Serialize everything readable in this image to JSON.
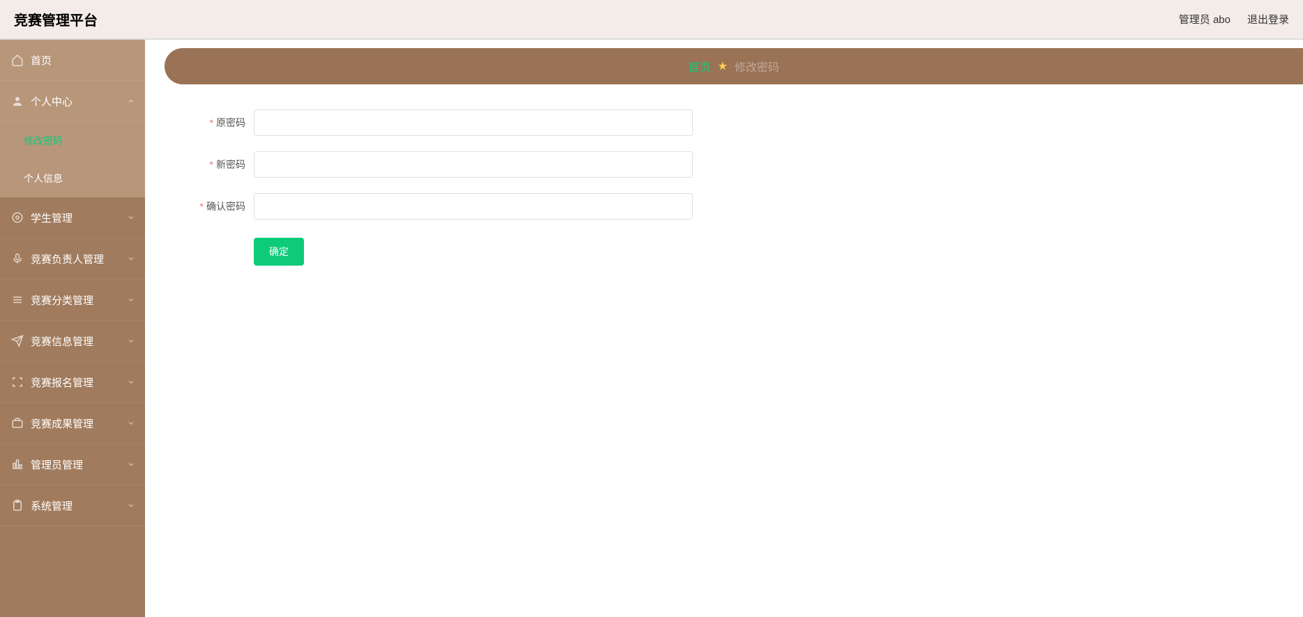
{
  "header": {
    "title": "竞赛管理平台",
    "user_label": "管理员 abo",
    "logout_label": "退出登录"
  },
  "sidebar": {
    "items": [
      {
        "label": "首页",
        "icon": "home",
        "expandable": false,
        "light": true
      },
      {
        "label": "个人中心",
        "icon": "user",
        "expandable": true,
        "light": true,
        "expanded": true,
        "children": [
          {
            "label": "修改密码",
            "active": true
          },
          {
            "label": "个人信息",
            "active": false
          }
        ]
      },
      {
        "label": "学生管理",
        "icon": "gear",
        "expandable": true
      },
      {
        "label": "竞赛负责人管理",
        "icon": "mic",
        "expandable": true
      },
      {
        "label": "竞赛分类管理",
        "icon": "list",
        "expandable": true
      },
      {
        "label": "竞赛信息管理",
        "icon": "send",
        "expandable": true
      },
      {
        "label": "竞赛报名管理",
        "icon": "fullscreen",
        "expandable": true
      },
      {
        "label": "竞赛成果管理",
        "icon": "briefcase",
        "expandable": true
      },
      {
        "label": "管理员管理",
        "icon": "bar",
        "expandable": true
      },
      {
        "label": "系统管理",
        "icon": "clipboard",
        "expandable": true
      }
    ]
  },
  "breadcrumb": {
    "home": "首页",
    "current": "修改密码"
  },
  "form": {
    "old_password_label": "原密码",
    "new_password_label": "新密码",
    "confirm_password_label": "确认密码",
    "old_password_value": "",
    "new_password_value": "",
    "confirm_password_value": "",
    "submit_label": "确定"
  }
}
